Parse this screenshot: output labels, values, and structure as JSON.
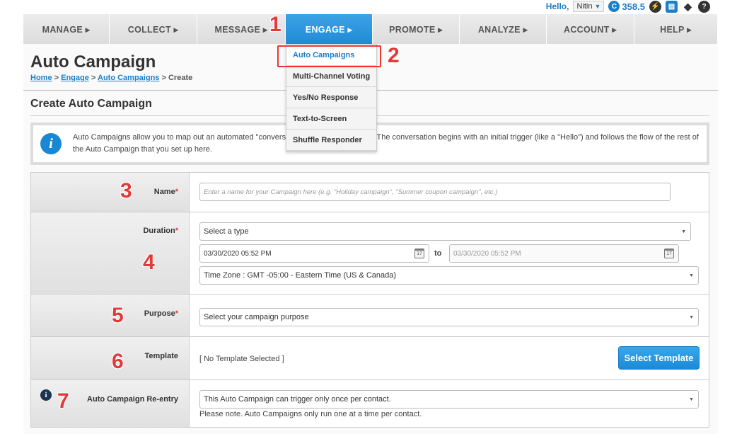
{
  "topbar": {
    "hello": "Hello,",
    "user": "Nitin",
    "credit_icon": "C",
    "credits": "358.5",
    "icons": [
      "bolt-icon",
      "inbox-icon",
      "graduation-cap-icon",
      "help-icon"
    ]
  },
  "nav": [
    {
      "label": "MANAGE ▸"
    },
    {
      "label": "COLLECT ▸"
    },
    {
      "label": "MESSAGE ▸"
    },
    {
      "label": "ENGAGE ▸"
    },
    {
      "label": "PROMOTE ▸"
    },
    {
      "label": "ANALYZE ▸"
    },
    {
      "label": "ACCOUNT ▸"
    },
    {
      "label": "HELP ▸"
    }
  ],
  "engage_menu": [
    {
      "label": "Auto Campaigns"
    },
    {
      "label": "Multi-Channel Voting"
    },
    {
      "label": "Yes/No Response"
    },
    {
      "label": "Text-to-Screen"
    },
    {
      "label": "Shuffle Responder"
    }
  ],
  "page": {
    "title": "Auto Campaign",
    "breadcrumb": {
      "home": "Home",
      "sep": ">",
      "engage": "Engage",
      "auto": "Auto Campaigns",
      "current": "Create"
    },
    "section_title": "Create Auto Campaign",
    "info_text": "Auto Campaigns allow you to map out an automated \"conversation\" with your audience. The conversation begins with an initial trigger (like a \"Hello\") and follows the flow of the rest of the Auto Campaign that you set up here."
  },
  "form": {
    "name": {
      "label": "Name",
      "req": "*",
      "placeholder": "Enter a name for your Campaign here (e.g. \"Holiday campaign\", \"Summer coupon campaign\", etc.)"
    },
    "duration": {
      "label": "Duration",
      "req": "*",
      "type_value": "Select a type",
      "start": "03/30/2020 05:52 PM",
      "to": "to",
      "end": "03/30/2020 05:52 PM",
      "timezone": "Time Zone : GMT -05:00 - Eastern Time (US & Canada)"
    },
    "purpose": {
      "label": "Purpose",
      "req": "*",
      "value": "Select your campaign purpose"
    },
    "template": {
      "label": "Template",
      "value": "[ No Template Selected ]",
      "button": "Select Template"
    },
    "reentry": {
      "label": "Auto Campaign Re-entry",
      "info_icon": "i",
      "value": "This Auto Campaign can trigger only once per contact.",
      "note": "Please note. Auto Campaigns only run one at a time per contact."
    }
  },
  "annotations": [
    "1",
    "2",
    "3",
    "4",
    "5",
    "6",
    "7"
  ],
  "colors": {
    "accent": "#1a7fc9",
    "annotation": "#e03a3a"
  }
}
